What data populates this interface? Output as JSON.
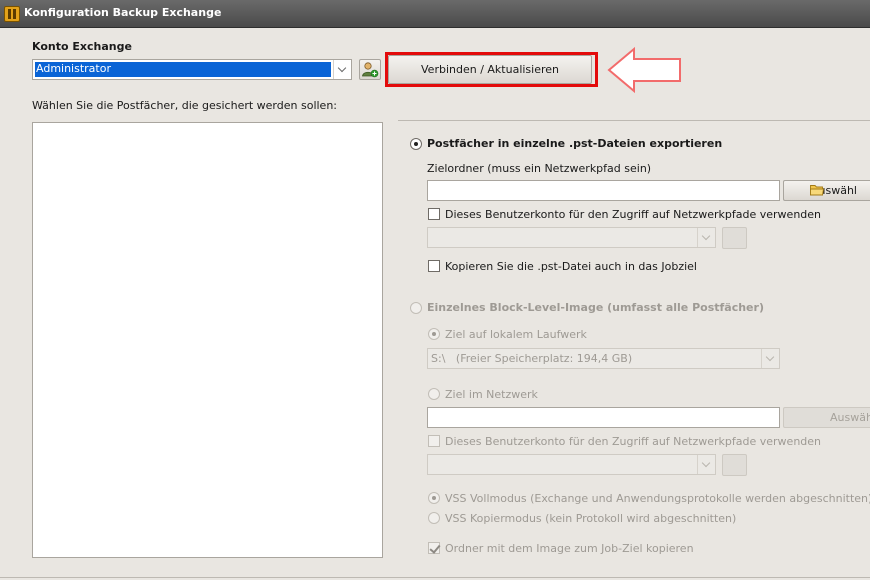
{
  "window": {
    "title": "Konfiguration Backup Exchange"
  },
  "account": {
    "label": "Konto Exchange",
    "selected": "Administrator",
    "connect_button": "Verbinden / Aktualisieren"
  },
  "mailbox_list": {
    "label": "Wählen Sie die Postfächer, die gesichert werden sollen:",
    "items": []
  },
  "pst_export": {
    "option_label": "Postfächer in einzelne .pst-Dateien exportieren",
    "target_label": "Zielordner (muss ein Netzwerkpfad sein)",
    "target_value": "",
    "browse_button": "Auswähl",
    "use_account_label": "Dieses Benutzerkonto für den Zugriff auf Netzwerkpfade verwenden",
    "account_value": "",
    "copy_label": "Kopieren Sie die .pst-Datei auch in das Jobziel"
  },
  "image_export": {
    "option_label": "Einzelnes Block-Level-Image (umfasst alle Postfächer)",
    "local_label": "Ziel auf lokalem Laufwerk",
    "local_drive": "S:\\",
    "local_free": "(Freier Speicherplatz: 194,4 GB)",
    "network_label": "Ziel im Netzwerk",
    "network_value": "",
    "browse_button": "Auswähl",
    "use_account_label": "Dieses Benutzerkonto für den Zugriff auf Netzwerkpfade verwenden",
    "account_value": "",
    "vss_full_label": "VSS Vollmodus (Exchange und Anwendungsprotokolle werden abgeschnitten)",
    "vss_copy_label": "VSS Kopiermodus (kein Protokoll wird abgeschnitten)",
    "copy_folder_label": "Ordner mit dem Image zum Job-Ziel kopieren"
  },
  "colors": {
    "highlight": "#e30b0b",
    "arrow": "#f26b6b",
    "selection": "#0a64d6"
  }
}
